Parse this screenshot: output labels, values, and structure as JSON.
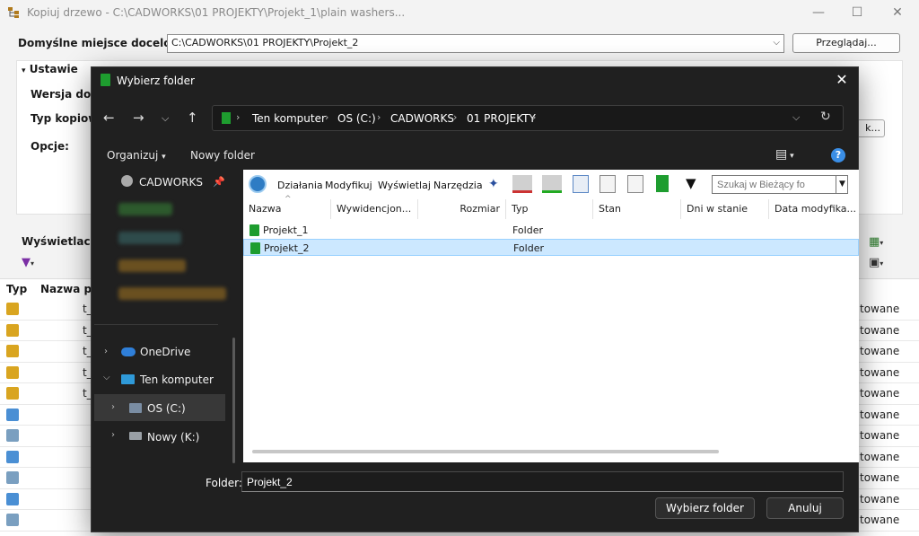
{
  "bg": {
    "title": "Kopiuj drzewo - C:\\CADWORKS\\01 PROJEKTY\\Projekt_1\\plain washers...",
    "dest_label": "Domyślne miejsce docelowe:",
    "dest_value": "C:\\CADWORKS\\01 PROJEKTY\\Projekt_2",
    "browse": "Przeglądaj...",
    "settings_header": "Ustawie",
    "wersja": "Wersja do uż",
    "typ_kopiowania": "Typ kopiowa",
    "opcje": "Opcje:",
    "peek_button": "k...",
    "filter_label": "Wyświetlacz filt",
    "col_typ": "Typ",
    "col_nazwa": "Nazwa plik",
    "rows": [
      {
        "text": "t_",
        "status": "towane"
      },
      {
        "text": "t_",
        "status": "towane"
      },
      {
        "text": "t_",
        "status": "towane"
      },
      {
        "text": "t_",
        "status": "towane"
      },
      {
        "text": "t_",
        "status": "towane"
      },
      {
        "text": "",
        "status": "towane"
      },
      {
        "text": "",
        "status": "towane"
      },
      {
        "text": "",
        "status": "towane"
      },
      {
        "text": "",
        "status": "towane"
      },
      {
        "text": "",
        "status": "towane"
      },
      {
        "text": "",
        "status": "towane"
      }
    ]
  },
  "dialog": {
    "title": "Wybierz folder",
    "address": {
      "segments": [
        "Ten komputer",
        "OS (C:)",
        "CADWORKS",
        "01 PROJEKTY"
      ]
    },
    "toolbar": {
      "organize": "Organizuj",
      "new_folder": "Nowy folder"
    },
    "nav": {
      "quick": "CADWORKS",
      "onedrive": "OneDrive",
      "this_pc": "Ten komputer",
      "os_c": "OS (C:)",
      "nowy_k": "Nowy (K:)"
    },
    "content_toolbar": {
      "dzialania": "Działania",
      "modyfikuj": "Modyfikuj",
      "wyswietlaj": "Wyświetlaj",
      "narzedzia": "Narzędzia",
      "search_placeholder": "Szukaj w Bieżący fo"
    },
    "columns": [
      "Nazwa",
      "Wywidencjon...",
      "Rozmiar",
      "Typ",
      "Stan",
      "Dni w stanie",
      "Data modyfika..."
    ],
    "rows": [
      {
        "name": "Projekt_1",
        "type": "Folder",
        "selected": false
      },
      {
        "name": "Projekt_2",
        "type": "Folder",
        "selected": true
      }
    ],
    "folder_label": "Folder:",
    "folder_value": "Projekt_2",
    "select_button": "Wybierz folder",
    "cancel_button": "Anuluj"
  },
  "colors": {
    "accent_folder": "#1e9d2f",
    "selection": "#cce8ff",
    "dialog_bg": "#202020"
  }
}
